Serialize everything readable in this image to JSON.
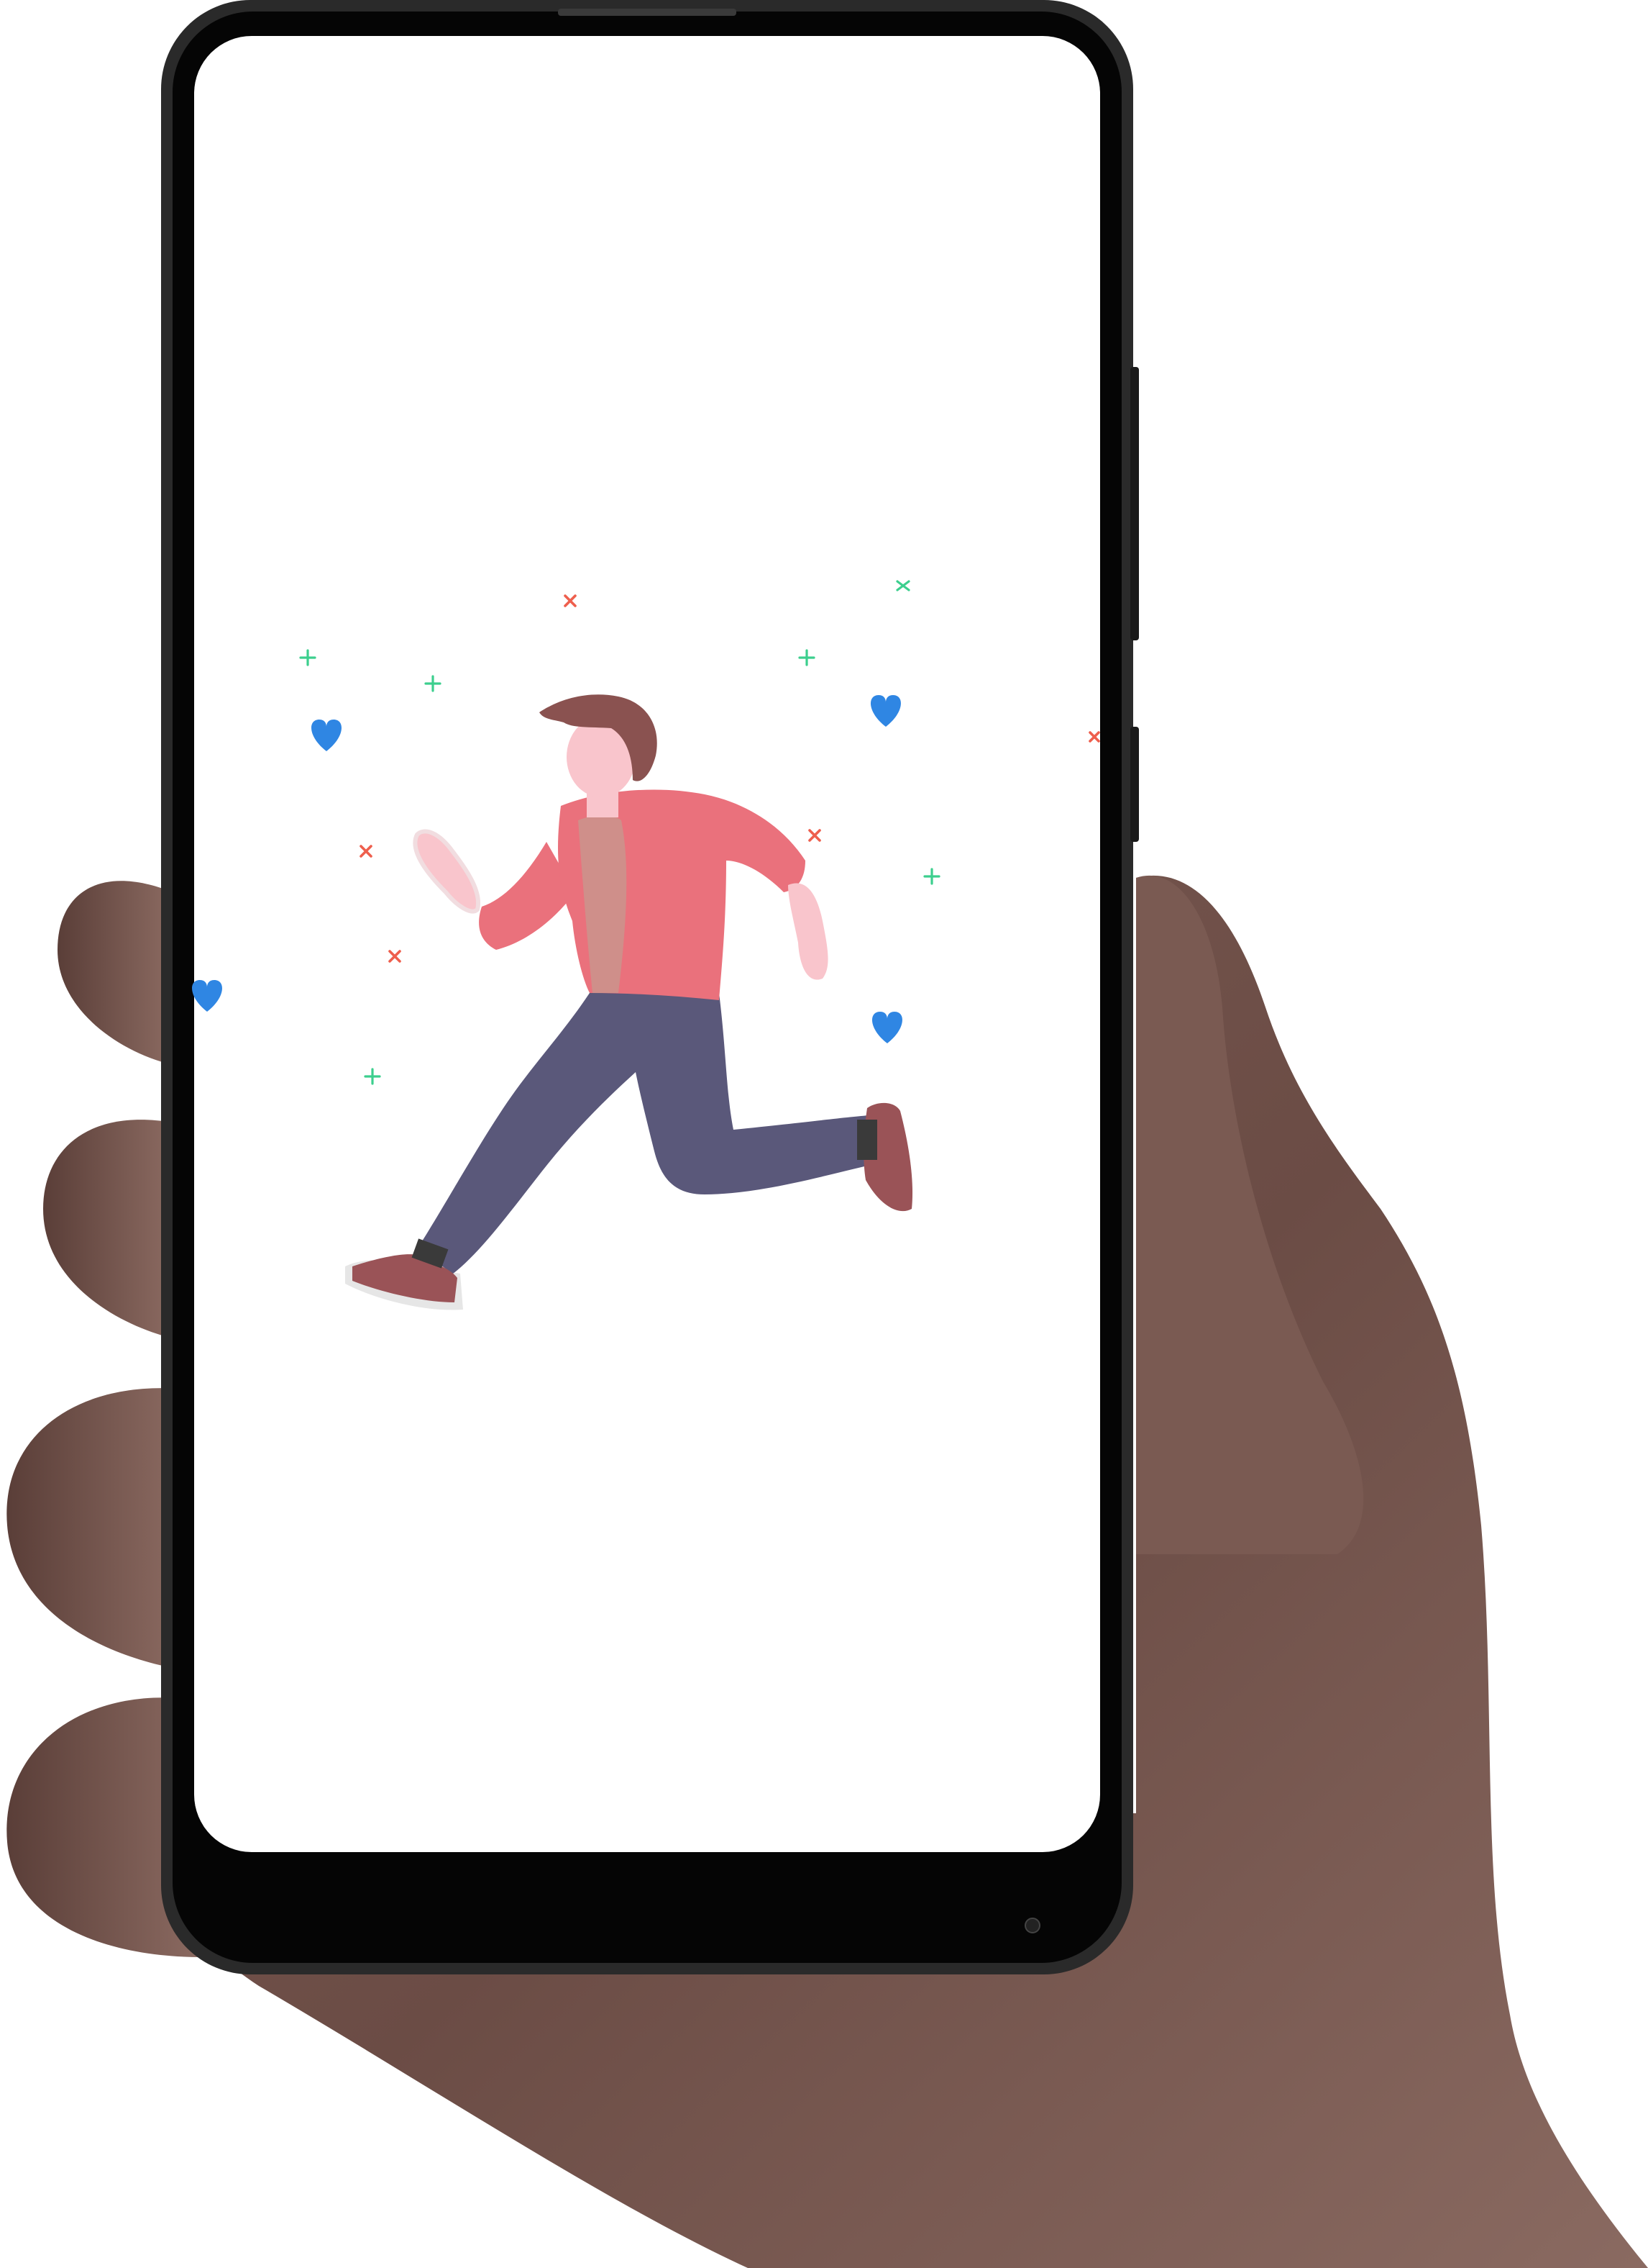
{
  "colors": {
    "phone_frame": "#1d1d1d",
    "phone_bezel": "#000000",
    "screen": "#ffffff",
    "skin_hand": "#6e5048",
    "skin_hand_light": "#8f6f66",
    "shirt": "#ea717c",
    "undershirt": "#cf8f8a",
    "pants": "#5a587a",
    "hair": "#8a5250",
    "face_skin": "#f9c5cc",
    "shoe": "#9a5357",
    "heart": "#2f86e3",
    "sparkle_green": "#3ccf8e",
    "sparkle_red": "#ee5f4d"
  },
  "icons": [
    "heart-icon",
    "plus-sparkle-icon",
    "cross-sparkle-icon"
  ]
}
